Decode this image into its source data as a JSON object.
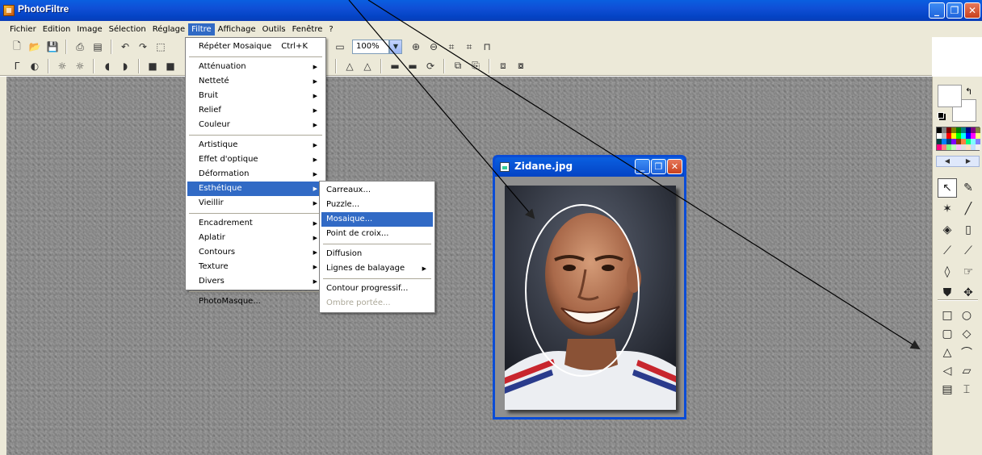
{
  "app": {
    "title": "PhotoFiltre",
    "window_buttons": {
      "minimize": "_",
      "restore": "❐",
      "close": "✕"
    }
  },
  "menubar": [
    {
      "label": "Fichier",
      "active": false
    },
    {
      "label": "Edition",
      "active": false
    },
    {
      "label": "Image",
      "active": false
    },
    {
      "label": "Sélection",
      "active": false
    },
    {
      "label": "Réglage",
      "active": false
    },
    {
      "label": "Filtre",
      "active": true
    },
    {
      "label": "Affichage",
      "active": false
    },
    {
      "label": "Outils",
      "active": false
    },
    {
      "label": "Fenêtre",
      "active": false
    },
    {
      "label": "?",
      "active": false
    }
  ],
  "toolbar": {
    "zoom_value": "100%"
  },
  "filter_menu": {
    "repeat": {
      "label": "Répéter Mosaique",
      "shortcut": "Ctrl+K"
    },
    "group1": [
      "Atténuation",
      "Netteté",
      "Bruit",
      "Relief",
      "Couleur"
    ],
    "group2": [
      "Artistique",
      "Effet d'optique",
      "Déformation",
      "Esthétique",
      "Vieillir"
    ],
    "highlighted": "Esthétique",
    "group3": [
      "Encadrement",
      "Aplatir",
      "Contours",
      "Texture",
      "Divers"
    ],
    "last": "PhotoMasque..."
  },
  "esthetique_submenu": {
    "group1": [
      "Carreaux...",
      "Puzzle...",
      "Mosaique...",
      "Point de croix..."
    ],
    "highlighted": "Mosaique...",
    "group2": [
      "Diffusion",
      "Lignes de balayage"
    ],
    "group3": [
      "Contour progressif...",
      "Ombre portée..."
    ],
    "disabled": "Ombre portée..."
  },
  "image_window": {
    "title": "Zidane.jpg"
  },
  "colors": {
    "accent": "#316ac5",
    "titlebar": "#0443c4",
    "menu_bg": "#ece9d8"
  }
}
